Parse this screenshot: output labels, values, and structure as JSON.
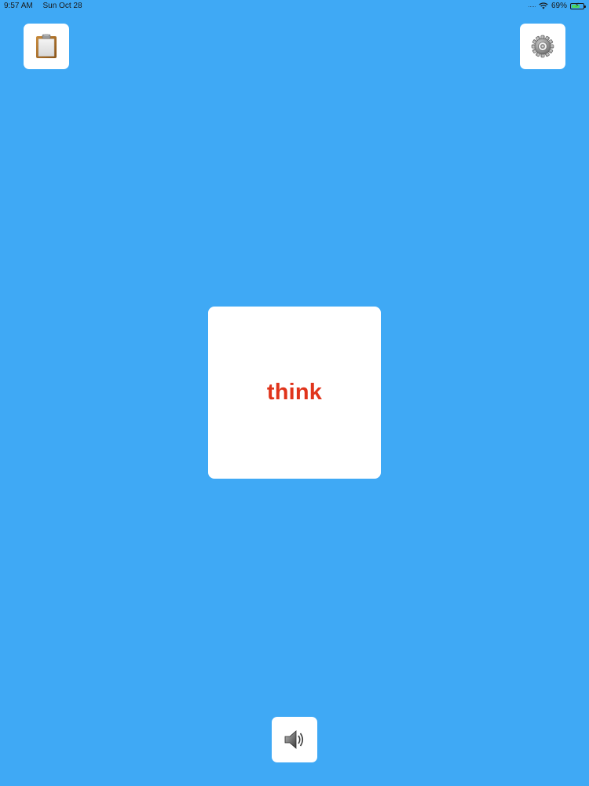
{
  "status_bar": {
    "time": "9:57 AM",
    "date": "Sun Oct 28",
    "battery_percent": "69%",
    "battery_level": 0.69,
    "signal_icon": "cellular-dots-icon",
    "wifi_icon": "wifi-icon",
    "battery_icon": "battery-charging-icon"
  },
  "toolbar": {
    "clipboard_icon": "clipboard-icon",
    "settings_icon": "gear-icon",
    "speaker_icon": "speaker-icon"
  },
  "card": {
    "word": "think",
    "word_color": "#e0341b"
  },
  "colors": {
    "background": "#3fa9f5",
    "tile": "#ffffff"
  }
}
